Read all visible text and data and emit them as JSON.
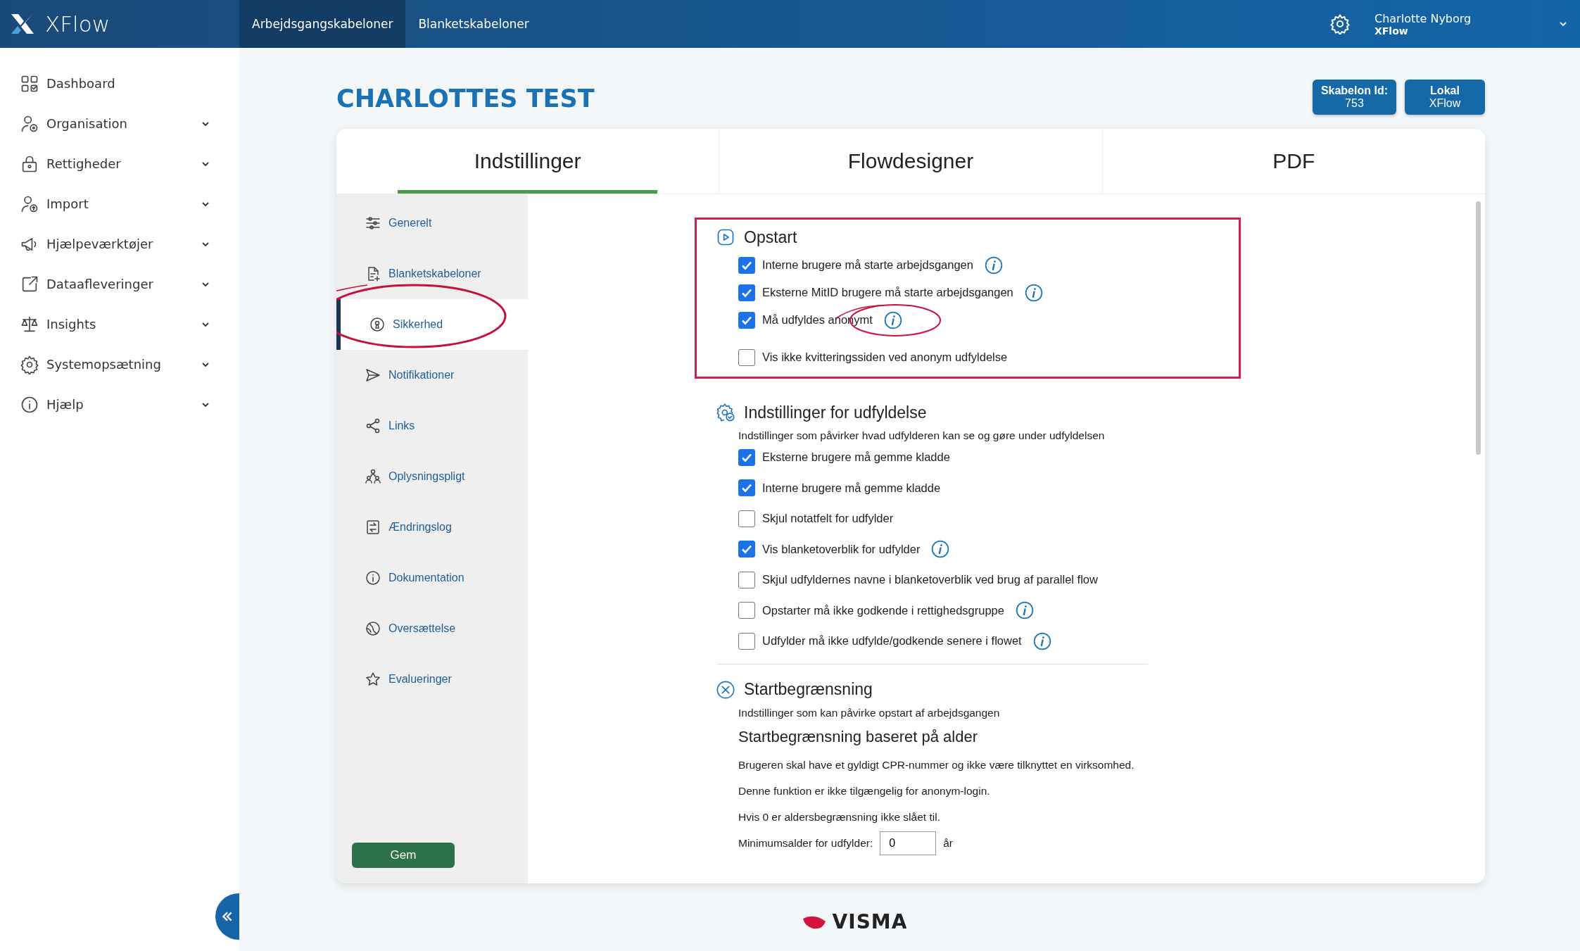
{
  "header": {
    "logo": "XFlow",
    "nav": [
      {
        "label": "Arbejdsgangskabeloner",
        "selected": true
      },
      {
        "label": "Blanketskabeloner",
        "selected": false
      }
    ],
    "user": {
      "name": "Charlotte Nyborg",
      "org": "XFlow"
    }
  },
  "sidebar": {
    "items": [
      {
        "label": "Dashboard",
        "has_submenu": false
      },
      {
        "label": "Organisation",
        "has_submenu": true
      },
      {
        "label": "Rettigheder",
        "has_submenu": true
      },
      {
        "label": "Import",
        "has_submenu": true
      },
      {
        "label": "Hjælpeværktøjer",
        "has_submenu": true
      },
      {
        "label": "Dataafleveringer",
        "has_submenu": true
      },
      {
        "label": "Insights",
        "has_submenu": true
      },
      {
        "label": "Systemopsætning",
        "has_submenu": true
      },
      {
        "label": "Hjælp",
        "has_submenu": true
      }
    ]
  },
  "page": {
    "title": "CHARLOTTES TEST",
    "badges": [
      {
        "label": "Skabelon Id:",
        "value": "753"
      },
      {
        "label": "Lokal",
        "value": "XFlow"
      }
    ]
  },
  "tabs": [
    {
      "label": "Indstillinger",
      "selected": true
    },
    {
      "label": "Flowdesigner",
      "selected": false
    },
    {
      "label": "PDF",
      "selected": false
    }
  ],
  "settings_nav": [
    {
      "label": "Generelt",
      "selected": false,
      "circled": false
    },
    {
      "label": "Blanketskabeloner",
      "selected": false,
      "circled": false
    },
    {
      "label": "Sikkerhed",
      "selected": true,
      "circled": true
    },
    {
      "label": "Notifikationer",
      "selected": false,
      "circled": false
    },
    {
      "label": "Links",
      "selected": false,
      "circled": false
    },
    {
      "label": "Oplysningspligt",
      "selected": false,
      "circled": false
    },
    {
      "label": "Ændringslog",
      "selected": false,
      "circled": false
    },
    {
      "label": "Dokumentation",
      "selected": false,
      "circled": false
    },
    {
      "label": "Oversættelse",
      "selected": false,
      "circled": false
    },
    {
      "label": "Evalueringer",
      "selected": false,
      "circled": false
    }
  ],
  "save_button": "Gem",
  "sections": [
    {
      "title": "Opstart",
      "highlighted": true,
      "options": [
        {
          "label": "Interne brugere må starte arbejdsgangen",
          "checked": true,
          "info": true,
          "circled": false
        },
        {
          "label": "Eksterne MitID brugere må starte arbejdsgangen",
          "checked": true,
          "info": true,
          "circled": false
        },
        {
          "label": "Må udfyldes anonymt",
          "checked": true,
          "info": true,
          "circled": true
        },
        {
          "label": "Vis ikke kvitteringssiden ved anonym udfyldelse",
          "checked": false,
          "info": false,
          "circled": false
        }
      ]
    },
    {
      "title": "Indstillinger for udfyldelse",
      "highlighted": false,
      "description": "Indstillinger som påvirker hvad udfylderen kan se og gøre under udfyldelsen",
      "options": [
        {
          "label": "Eksterne brugere må gemme kladde",
          "checked": true,
          "info": false,
          "circled": false
        },
        {
          "label": "Interne brugere må gemme kladde",
          "checked": true,
          "info": false,
          "circled": false
        },
        {
          "label": "Skjul notatfelt for udfylder",
          "checked": false,
          "info": false,
          "circled": false
        },
        {
          "label": "Vis blanketoverblik for udfylder",
          "checked": true,
          "info": true,
          "circled": false
        },
        {
          "label": "Skjul udfyldernes navne i blanketoverblik ved brug af parallel flow",
          "checked": false,
          "info": false,
          "circled": false
        },
        {
          "label": "Opstarter må ikke godkende i rettighedsgruppe",
          "checked": false,
          "info": true,
          "circled": false
        },
        {
          "label": "Udfylder må ikke udfylde/godkende senere i flowet",
          "checked": false,
          "info": true,
          "circled": false
        }
      ]
    },
    {
      "title": "Startbegrænsning",
      "highlighted": false,
      "description": "Indstillinger som kan påvirke opstart af arbejdsgangen",
      "subtitle": "Startbegrænsning baseret på alder",
      "paragraphs": [
        "Brugeren skal have et gyldigt CPR-nummer og ikke være tilknyttet en virksomhed.",
        "Denne funktion er ikke tilgængelig for anonym-login.",
        "Hvis 0 er aldersbegrænsning ikke slået til."
      ],
      "field": {
        "label": "Minimumsalder for udfylder:",
        "value": "0",
        "unit": "år"
      }
    }
  ],
  "footer": {
    "logo": "VISMA"
  }
}
